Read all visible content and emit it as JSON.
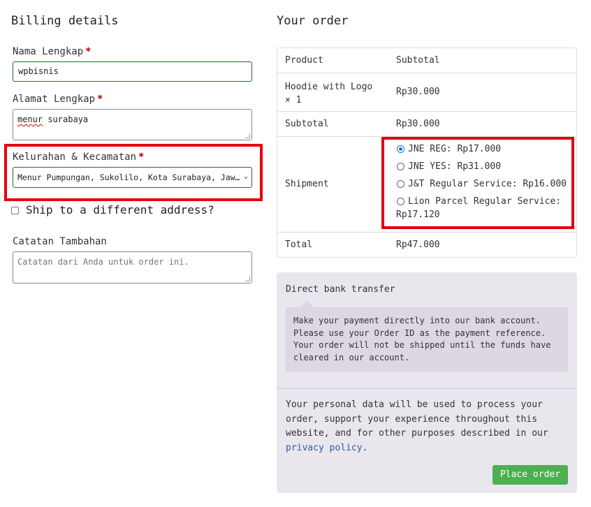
{
  "billing": {
    "heading": "Billing details",
    "name_label": "Nama Lengkap",
    "name_value": "wpbisnis",
    "address_label": "Alamat Lengkap",
    "address_value_1": "menur",
    "address_value_2": " surabaya",
    "district_label": "Kelurahan & Kecamatan",
    "district_value": "Menur Pumpungan, Sukolilo, Kota Surabaya, Jaw…",
    "required_mark": "*",
    "ship_label": "Ship to a different address?",
    "notes_label": "Catatan Tambahan",
    "notes_placeholder": "Catatan dari Anda untuk order ini."
  },
  "order": {
    "heading": "Your order",
    "col_product": "Product",
    "col_subtotal": "Subtotal",
    "item_name": "Hoodie with Logo",
    "item_qty": "× 1",
    "item_price": "Rp30.000",
    "subtotal_label": "Subtotal",
    "subtotal_value": "Rp30.000",
    "shipment_label": "Shipment",
    "shipping_options": [
      {
        "label": "JNE REG: Rp17.000",
        "checked": true
      },
      {
        "label": "JNE YES: Rp31.000",
        "checked": false
      },
      {
        "label": "J&T Regular Service: Rp16.000",
        "checked": false
      },
      {
        "label_line1": "Lion Parcel Regular Service:",
        "label_line2": "Rp17.120",
        "checked": false
      }
    ],
    "total_label": "Total",
    "total_value": "Rp47.000"
  },
  "payment": {
    "method": "Direct bank transfer",
    "description": [
      "Make your payment directly into our bank account.",
      "Please use your Order ID as the payment reference.",
      "Your order will not be shipped until the funds have",
      "cleared in our account."
    ],
    "privacy_text": [
      "Your personal data will be used to process your",
      "order, support your experience throughout this",
      "website, and for other purposes described in our"
    ],
    "privacy_link": "privacy policy",
    "privacy_end": ".",
    "place_order": "Place order",
    "button_color": "#4caf50"
  },
  "highlight_color": "#e30010"
}
